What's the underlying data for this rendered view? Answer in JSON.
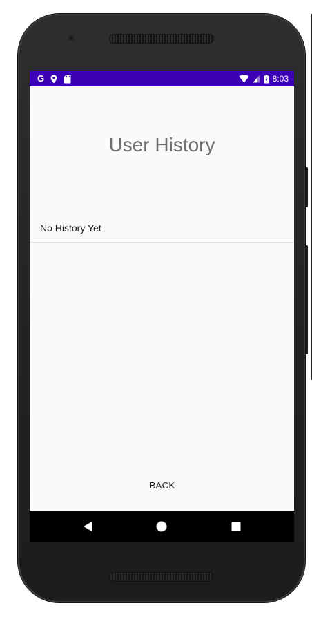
{
  "status_bar": {
    "time": "8:03",
    "left_icons": [
      "google-g-icon",
      "location-pin-icon",
      "sd-card-icon"
    ],
    "right_icons": [
      "wifi-icon",
      "cell-signal-icon",
      "battery-icon"
    ],
    "google_letter": "G",
    "background_color": "#3d01b5"
  },
  "screen": {
    "title": "User History",
    "history_items": [
      "No History Yet"
    ],
    "back_label": "BACK"
  },
  "nav_bar": {
    "buttons": [
      "back-triangle-icon",
      "home-circle-icon",
      "recents-square-icon"
    ]
  }
}
